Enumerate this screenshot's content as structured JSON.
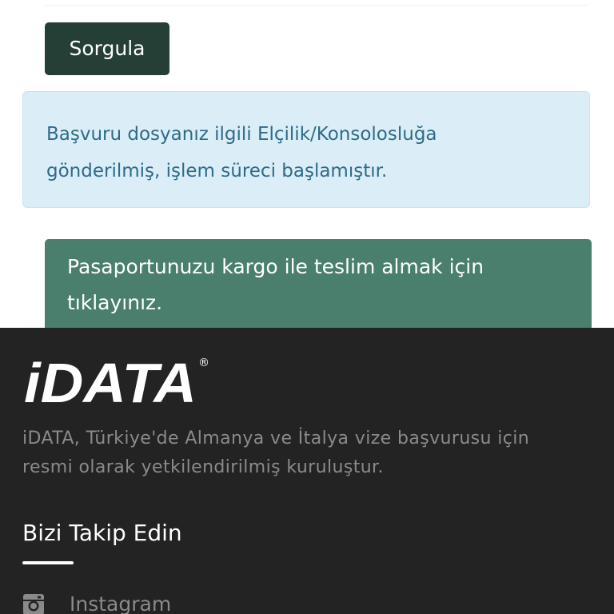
{
  "query": {
    "button_label": "Sorgula"
  },
  "status_alert": {
    "line1": "Başvuru dosyanız ilgili Elçilik/Konsolosluğa",
    "line2": "gönderilmiş, işlem süreci başlamıştır."
  },
  "cargo_link": {
    "line1": "Pasaportunuzu kargo ile teslim almak için",
    "line2": "tıklayınız."
  },
  "footer": {
    "logo_text": "iDATA",
    "registered_mark": "®",
    "description_line1": "iDATA, Türkiye'de Almanya ve İtalya vize başvurusu için",
    "description_line2": "resmi olarak yetkilendirilmiş kuruluştur.",
    "follow_title": "Bizi Takip Edin",
    "social": [
      {
        "icon": "instagram-icon",
        "label": "Instagram"
      }
    ]
  },
  "colors": {
    "button_bg": "#253f37",
    "alert_bg": "#dbeef7",
    "alert_text": "#2e6b89",
    "cargo_bg": "#4a7f6e",
    "footer_bg": "#232323",
    "footer_muted_text": "#8a8a8a"
  }
}
